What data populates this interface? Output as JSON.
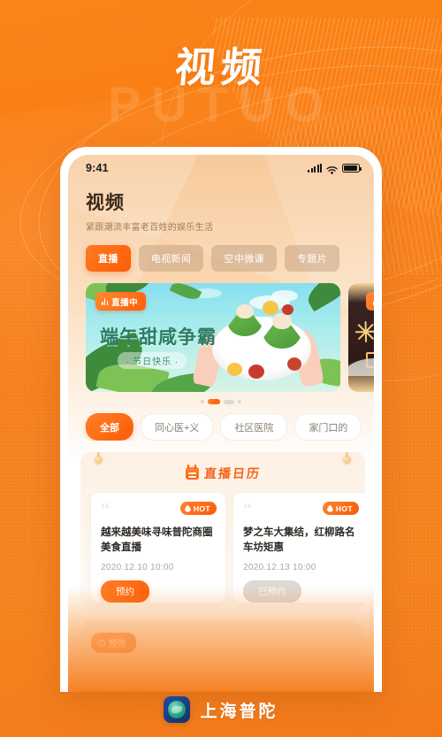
{
  "promo": {
    "title": "视频",
    "watermark": "PUTUO"
  },
  "phone": {
    "status_bar": {
      "time": "9:41",
      "signal_icon": "signal-bars-icon",
      "wifi_icon": "wifi-icon",
      "battery_icon": "battery-icon"
    },
    "page": {
      "title": "视频",
      "subtitle": "紧跟潮流丰富老百姓的娱乐生活"
    },
    "tabs": [
      {
        "label": "直播",
        "active": true
      },
      {
        "label": "电视新闻",
        "active": false
      },
      {
        "label": "空中微课",
        "active": false
      },
      {
        "label": "专题片",
        "active": false
      }
    ],
    "banners": [
      {
        "badge": "直播中",
        "title": "端午甜咸争霸",
        "subtitle": "· 节日快乐 ·"
      },
      {
        "badge": "直"
      }
    ],
    "pager": {
      "dots": 4,
      "active_index": 1
    },
    "chips": [
      {
        "label": "全部",
        "active": true
      },
      {
        "label": "同心医+义",
        "active": false
      },
      {
        "label": "社区医院",
        "active": false
      },
      {
        "label": "家门口的",
        "active": false
      }
    ],
    "calendar": {
      "title": "直播日历",
      "icon": "calendar-icon",
      "cards": [
        {
          "badge": "HOT",
          "title": "越来越美味寻味普陀商圈美食直播",
          "date": "2020.12.10 10:00",
          "button": "预约",
          "booked": false
        },
        {
          "badge": "HOT",
          "title": "梦之车大集结，红柳路名车坊矩惠",
          "date": "2020.12.13 10:00",
          "button": "已预约",
          "booked": true
        }
      ]
    },
    "next_section": {
      "badge": "预告"
    }
  },
  "appbar": {
    "name": "上海普陀",
    "icon": "app-logo-icon"
  },
  "colors": {
    "brand_orange": "#fa5c05",
    "brand_orange_light": "#ff7f28",
    "bg_orange": "#f4811f",
    "banner_teal": "#2a7d63"
  }
}
